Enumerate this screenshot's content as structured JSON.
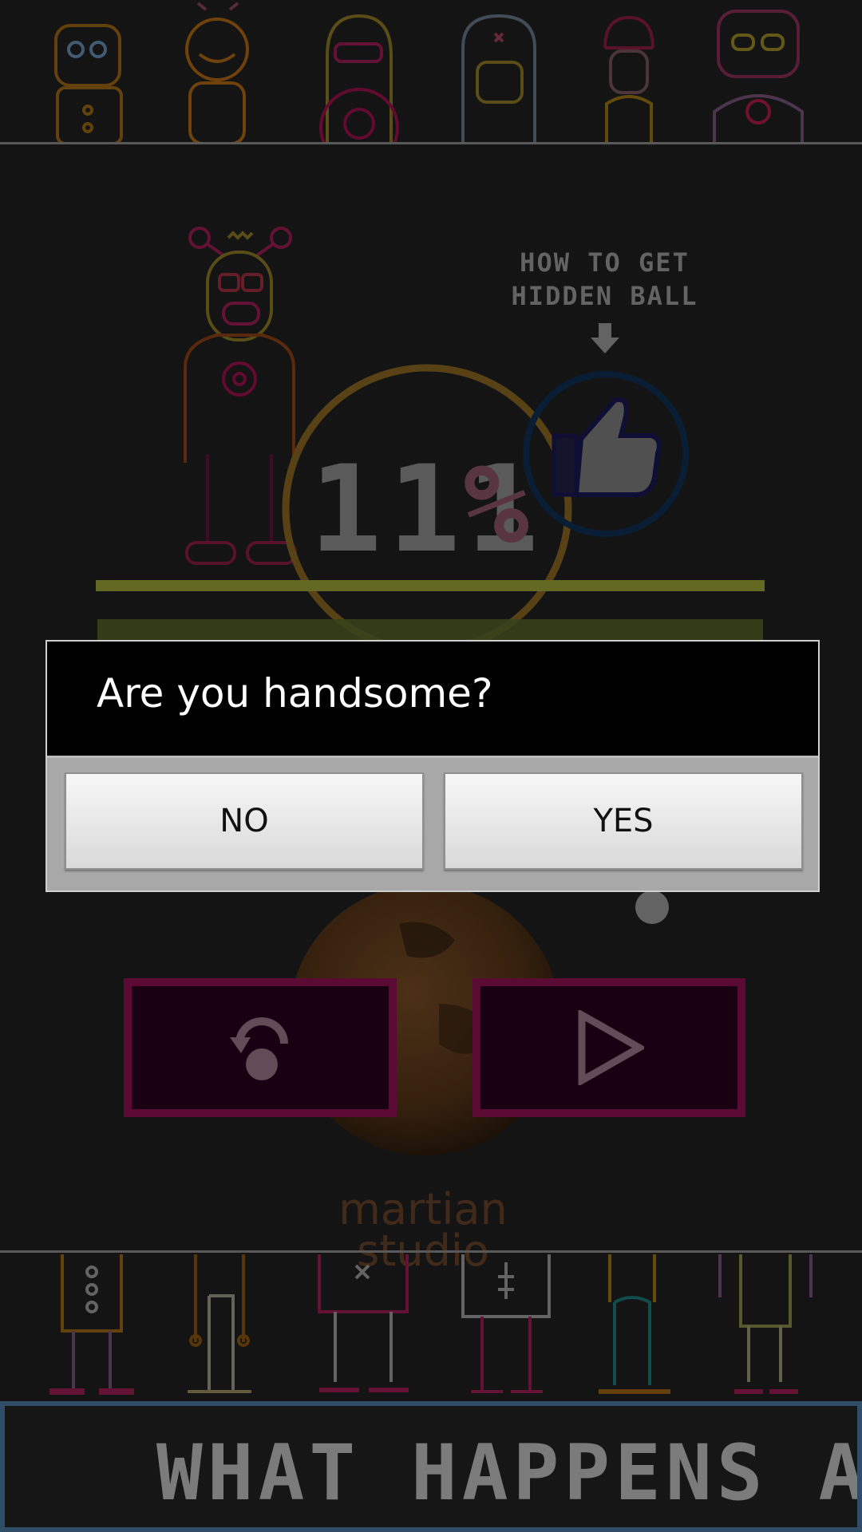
{
  "hint": {
    "line1": "HOW TO GET",
    "line2": "HIDDEN BALL",
    "arrow_icon": "arrow-down-icon",
    "like_icon": "thumbs-up-icon"
  },
  "score": {
    "value": "111",
    "unit": "%"
  },
  "studio": {
    "line1": "martian",
    "line2": "studio"
  },
  "controls": {
    "restart_icon": "restart-icon",
    "play_icon": "play-icon"
  },
  "dialog": {
    "title": "Are you handsome?",
    "no_label": "NO",
    "yes_label": "YES"
  },
  "banner": {
    "text": "WHAT HAPPENS AFT"
  },
  "colors": {
    "background": "#1c1c1c",
    "accent_magenta": "#7f0f48",
    "olive_bar": "#8a9230",
    "ring_orange": "#7a5a1e",
    "ring_blue": "#0d2a4a",
    "banner_border": "#2f4d66"
  }
}
